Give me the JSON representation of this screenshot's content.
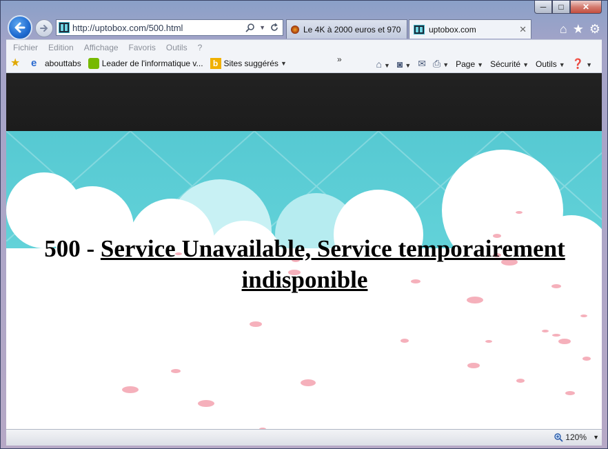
{
  "browser": {
    "window_controls": {
      "minimize": "─",
      "maximize": "□",
      "close": "✕"
    },
    "address": {
      "url": "http://uptobox.com/500.html"
    },
    "tabs": [
      {
        "label": "Le 4K à 2000 euros et 970 ...",
        "active": false
      },
      {
        "label": "uptobox.com",
        "active": true,
        "close": "✕"
      }
    ],
    "menubar": [
      "Fichier",
      "Edition",
      "Affichage",
      "Favoris",
      "Outils",
      "?"
    ],
    "favorites": [
      {
        "label": "abouttabs",
        "icon": "ie-icon"
      },
      {
        "label": "Leader de l'informatique v...",
        "icon": "nvidia-icon"
      },
      {
        "label": "Sites suggérés",
        "icon": "bing-icon"
      }
    ],
    "command_bar": {
      "page": "Page",
      "security": "Sécurité",
      "tools": "Outils",
      "overflow": "»"
    },
    "status": {
      "zoom": "120%"
    }
  },
  "page": {
    "error_code": "500 - ",
    "error_message": "Service Unavailable, Service temporairement indisponible"
  },
  "colors": {
    "sky": "#5fd0d8",
    "header": "#1f1f1f",
    "petal": "#f4a3b0"
  }
}
